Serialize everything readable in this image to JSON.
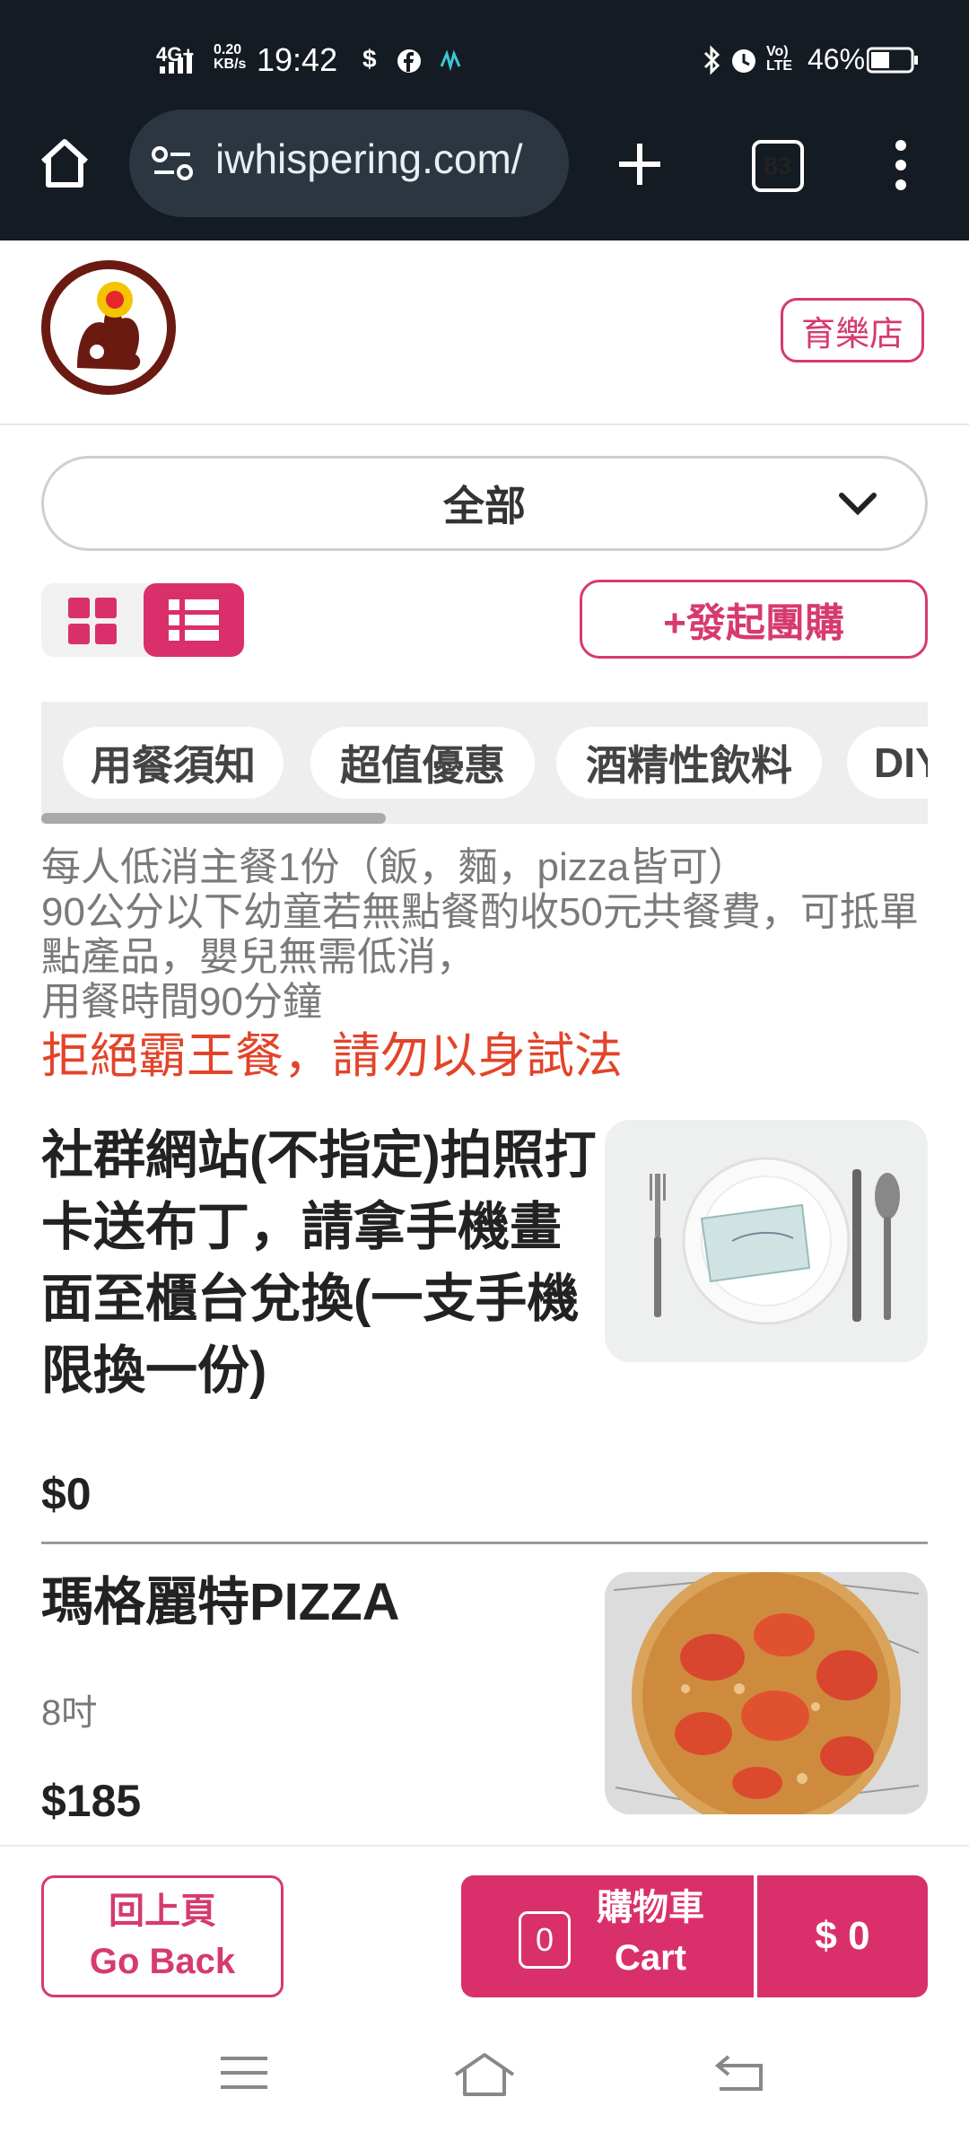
{
  "status_bar": {
    "network": "4G+",
    "speed": "0.20\nKB/s",
    "time": "19:42",
    "battery": "46%",
    "icons": [
      "signal-icon",
      "dollar-icon",
      "facebook-icon",
      "app-icon",
      "bluetooth-icon",
      "alarm-icon",
      "volte-icon",
      "battery-icon"
    ]
  },
  "browser": {
    "url": "iwhispering.com/",
    "tab_count": "83",
    "icons": [
      "home-icon",
      "site-settings-icon",
      "new-tab-icon",
      "tabs-icon",
      "menu-icon"
    ]
  },
  "header": {
    "store_label": "育樂店"
  },
  "filter": {
    "selected": "全部"
  },
  "toolbar": {
    "group_buy_label": "+發起團購"
  },
  "category_tabs": [
    {
      "label": "用餐須知"
    },
    {
      "label": "超值優惠"
    },
    {
      "label": "酒精性飲料"
    },
    {
      "label": "DIY"
    }
  ],
  "notice": {
    "lines": [
      "每人低消主餐1份（飯，麵，pizza皆可）",
      "90公分以下幼童若無點餐酌收50元共餐費，可抵單點產品，嬰兒無需低消，",
      "用餐時間90分鐘"
    ],
    "warning": "拒絕霸王餐，請勿以身試法"
  },
  "items": [
    {
      "title": "社群網站(不指定)拍照打卡送布丁，請拿手機畫面至櫃台兌換(一支手機限換一份)",
      "subtitle": "",
      "price": "$0"
    },
    {
      "title": "瑪格麗特PIZZA",
      "subtitle": "8吋",
      "price": "$185"
    }
  ],
  "bottom_bar": {
    "back_zh": "回上頁",
    "back_en": "Go Back",
    "cart_count": "0",
    "cart_zh": "購物車",
    "cart_en": "Cart",
    "total": "$ 0"
  },
  "colors": {
    "accent": "#d9306b",
    "warning": "#e2442a",
    "chrome_bg": "#141b22"
  }
}
